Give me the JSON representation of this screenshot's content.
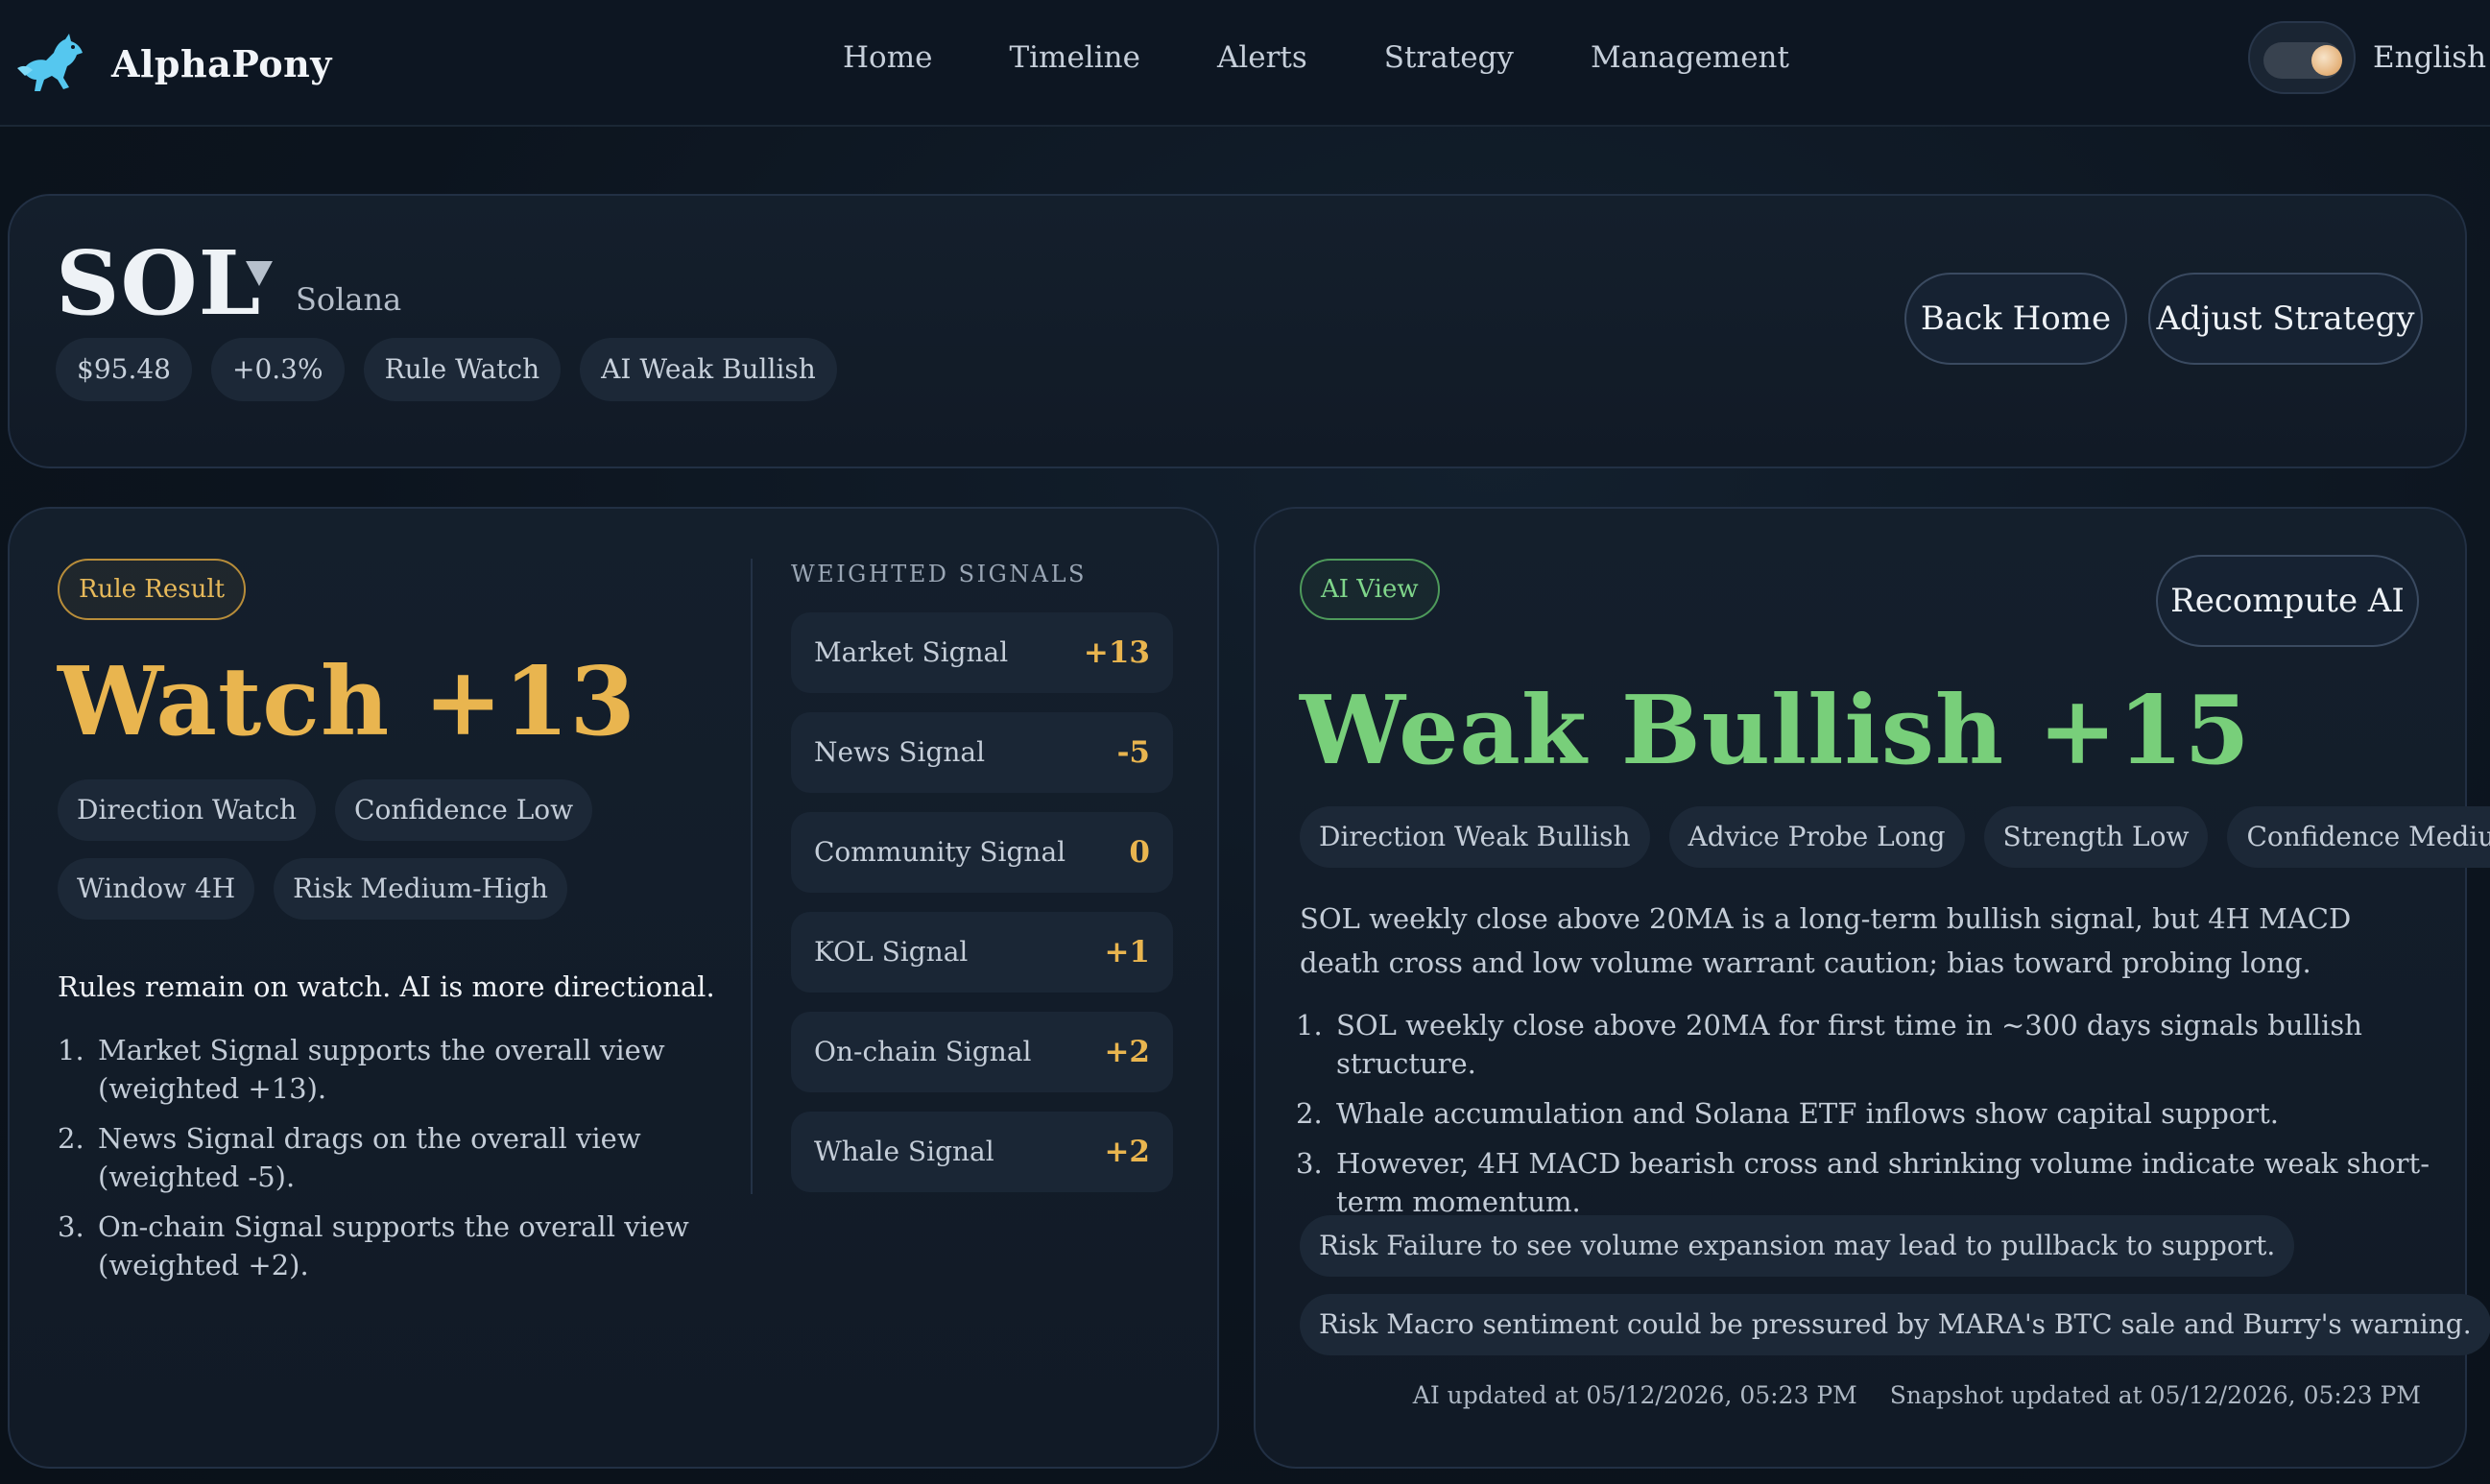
{
  "nav": {
    "brand": "AlphaPony",
    "links": [
      "Home",
      "Timeline",
      "Alerts",
      "Strategy",
      "Management"
    ],
    "language": "English"
  },
  "header": {
    "symbol": "SOL",
    "name": "Solana",
    "chips": [
      "$95.48",
      "+0.3%",
      "Rule Watch",
      "AI Weak Bullish"
    ],
    "back_label": "Back Home",
    "adjust_label": "Adjust Strategy"
  },
  "rule": {
    "tag": "Rule Result",
    "headline": "Watch +13",
    "chips_row1": [
      "Direction Watch",
      "Confidence Low"
    ],
    "chips_row2": [
      "Window 4H",
      "Risk Medium-High"
    ],
    "summary": "Rules remain on watch. AI is more directional.",
    "reasons": [
      "Market Signal supports the overall view (weighted +13).",
      "News Signal drags on the overall view (weighted -5).",
      "On-chain Signal supports the overall view (weighted +2)."
    ],
    "signals_title": "WEIGHTED SIGNALS",
    "signals": [
      {
        "name": "Market Signal",
        "value": "+13"
      },
      {
        "name": "News Signal",
        "value": "-5"
      },
      {
        "name": "Community Signal",
        "value": "0"
      },
      {
        "name": "KOL Signal",
        "value": "+1"
      },
      {
        "name": "On-chain Signal",
        "value": "+2"
      },
      {
        "name": "Whale Signal",
        "value": "+2"
      }
    ]
  },
  "ai": {
    "tag": "AI View",
    "recompute_label": "Recompute AI",
    "headline": "Weak Bullish +15",
    "chips": [
      "Direction Weak Bullish",
      "Advice Probe Long",
      "Strength Low",
      "Confidence Medium"
    ],
    "summary": "SOL weekly close above 20MA is a long-term bullish signal, but 4H MACD death cross and low volume warrant caution; bias toward probing long.",
    "points": [
      "SOL weekly close above 20MA for first time in ~300 days signals bullish structure.",
      "Whale accumulation and Solana ETF inflows show capital support.",
      "However, 4H MACD bearish cross and shrinking volume indicate weak short-term momentum."
    ],
    "risks": [
      "Risk Failure to see volume expansion may lead to pullback to support.",
      "Risk Macro sentiment could be pressured by MARA's BTC sale and Burry's warning."
    ],
    "ai_updated": "AI updated at 05/12/2026, 05:23 PM",
    "snapshot_updated": "Snapshot updated at 05/12/2026, 05:23 PM"
  },
  "colors": {
    "rule_accent": "#e9b54f",
    "ai_accent": "#78cf7a"
  }
}
